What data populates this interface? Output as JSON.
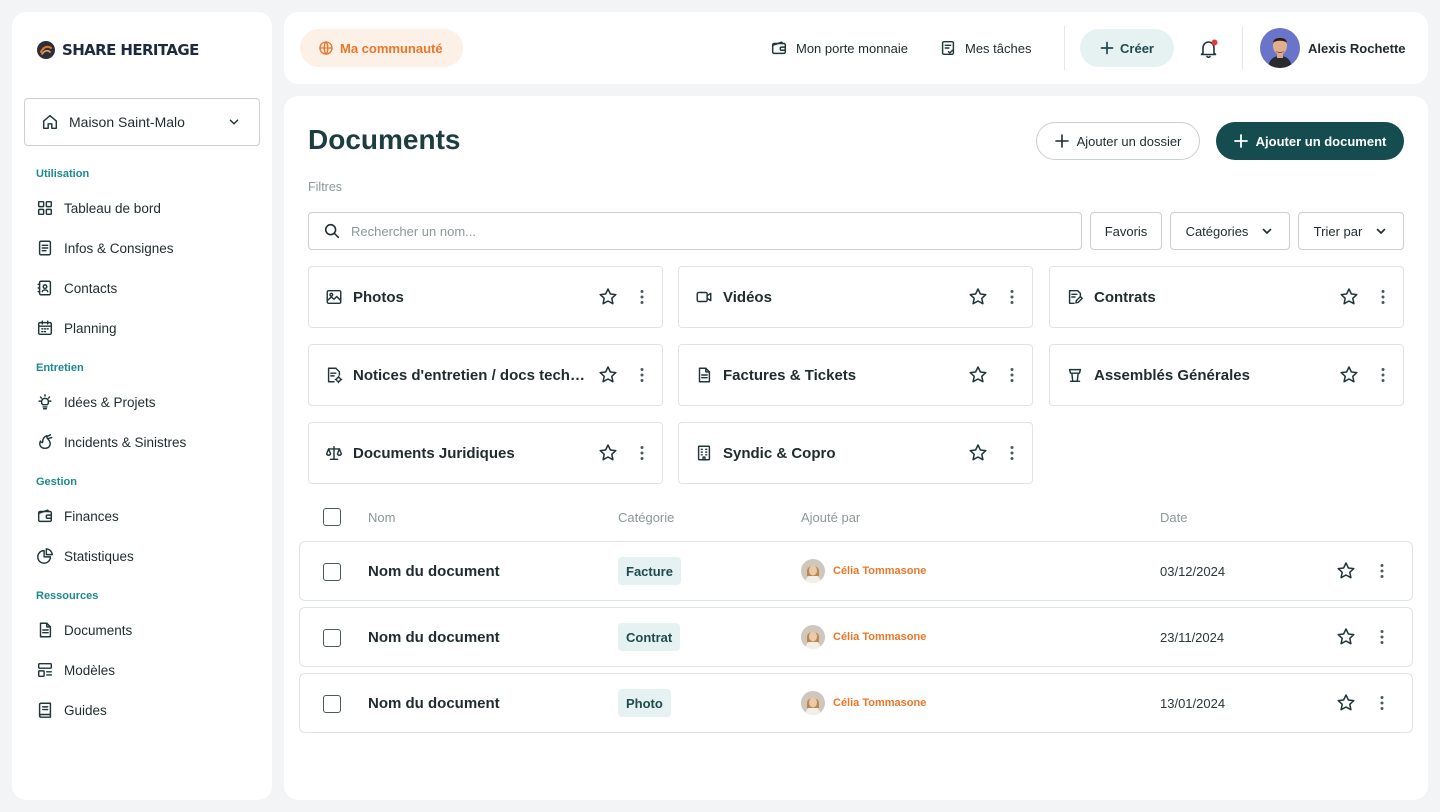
{
  "brand": {
    "name": "SHARE HERITAGE"
  },
  "sidebar": {
    "house": "Maison Saint-Malo",
    "sections": [
      {
        "title": "Utilisation",
        "items": [
          {
            "label": "Tableau de bord",
            "icon": "dashboard-icon"
          },
          {
            "label": "Infos & Consignes",
            "icon": "info-doc-icon"
          },
          {
            "label": "Contacts",
            "icon": "contacts-icon"
          },
          {
            "label": "Planning",
            "icon": "calendar-icon"
          }
        ]
      },
      {
        "title": "Entretien",
        "items": [
          {
            "label": "Idées & Projets",
            "icon": "bulb-icon"
          },
          {
            "label": "Incidents & Sinistres",
            "icon": "incident-icon"
          }
        ]
      },
      {
        "title": "Gestion",
        "items": [
          {
            "label": "Finances",
            "icon": "wallet-icon"
          },
          {
            "label": "Statistiques",
            "icon": "pie-chart-icon"
          }
        ]
      },
      {
        "title": "Ressources",
        "items": [
          {
            "label": "Documents",
            "icon": "document-icon"
          },
          {
            "label": "Modèles",
            "icon": "template-icon"
          },
          {
            "label": "Guides",
            "icon": "book-icon"
          }
        ]
      }
    ]
  },
  "topbar": {
    "community": "Ma communauté",
    "wallet": "Mon porte monnaie",
    "tasks": "Mes tâches",
    "create": "Créer",
    "user_name": "Alexis Rochette",
    "notification_dot_color": "#e23b3b"
  },
  "main": {
    "title": "Documents",
    "add_folder": "Ajouter un dossier",
    "add_document": "Ajouter un document",
    "filters_label": "Filtres",
    "search_placeholder": "Rechercher un nom...",
    "favorites": "Favoris",
    "categories": "Catégories",
    "sort": "Trier par"
  },
  "folders": [
    {
      "label": "Photos",
      "icon": "image-icon"
    },
    {
      "label": "Vidéos",
      "icon": "video-icon"
    },
    {
      "label": "Contrats",
      "icon": "contract-icon"
    },
    {
      "label": "Notices d'entretien / docs techniques",
      "icon": "notice-icon"
    },
    {
      "label": "Factures & Tickets",
      "icon": "invoice-icon"
    },
    {
      "label": "Assemblés Générales",
      "icon": "podium-icon"
    },
    {
      "label": "Documents Juridiques",
      "icon": "scale-icon"
    },
    {
      "label": "Syndic & Copro",
      "icon": "building-icon"
    }
  ],
  "table": {
    "headers": {
      "name": "Nom",
      "category": "Catégorie",
      "added_by": "Ajouté par",
      "date": "Date"
    },
    "rows": [
      {
        "name": "Nom du document",
        "category": "Facture",
        "author": "Célia Tommasone",
        "date": "03/12/2024"
      },
      {
        "name": "Nom du document",
        "category": "Contrat",
        "author": "Célia Tommasone",
        "date": "23/11/2024"
      },
      {
        "name": "Nom du document",
        "category": "Photo",
        "author": "Célia Tommasone",
        "date": "13/01/2024"
      }
    ]
  },
  "colors": {
    "primary": "#144c4f",
    "accent_orange": "#e8772b",
    "section_teal": "#1d8a8a",
    "tag_bg": "#e6f1f1"
  }
}
